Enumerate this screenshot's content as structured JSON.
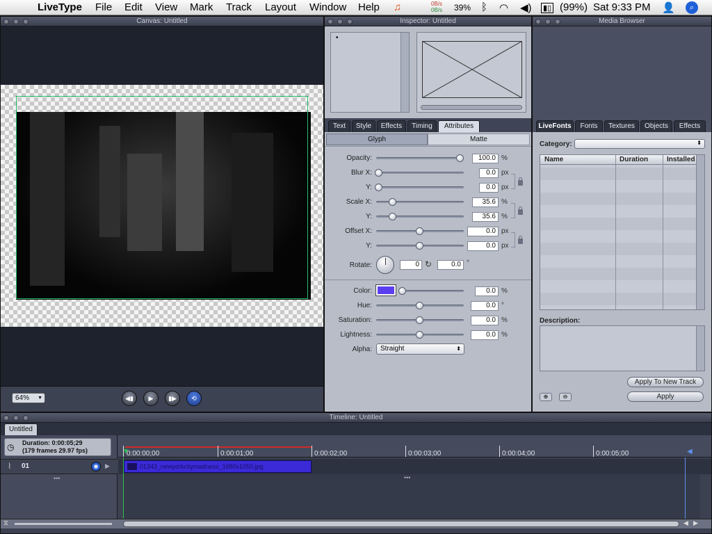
{
  "menubar": {
    "app": "LiveType",
    "menus": [
      "File",
      "Edit",
      "View",
      "Mark",
      "Track",
      "Layout",
      "Window",
      "Help"
    ],
    "net_up": "0B/s",
    "net_down": "0B/s",
    "cpu": "39%",
    "battery": "(99%)",
    "clock": "Sat 9:33 PM"
  },
  "canvas": {
    "title": "Canvas: Untitled",
    "zoom": "64%"
  },
  "inspector": {
    "title": "Inspector: Untitled",
    "tabs": [
      "Text",
      "Style",
      "Effects",
      "Timing",
      "Attributes"
    ],
    "active_tab": "Attributes",
    "subtabs": [
      "Glyph",
      "Matte"
    ],
    "active_subtab": "Glyph",
    "params": {
      "opacity": {
        "label": "Opacity:",
        "value": "100.0",
        "unit": "%",
        "slider": 0.97
      },
      "blur_x": {
        "label": "Blur X:",
        "value": "0.0",
        "unit": "px",
        "slider": 0.0
      },
      "blur_y": {
        "label": "Y:",
        "value": "0.0",
        "unit": "px",
        "slider": 0.0
      },
      "scale_x": {
        "label": "Scale X:",
        "value": "35.6",
        "unit": "%",
        "slider": 0.16
      },
      "scale_y": {
        "label": "Y:",
        "value": "35.6",
        "unit": "%",
        "slider": 0.16
      },
      "offset_x": {
        "label": "Offset X:",
        "value": "0.0",
        "unit": "px",
        "slider": 0.5
      },
      "offset_y": {
        "label": "Y:",
        "value": "0.0",
        "unit": "px",
        "slider": 0.5
      },
      "rotate": {
        "label": "Rotate:",
        "turns": "0",
        "degrees": "0.0",
        "unit": "°"
      },
      "color": {
        "label": "Color:",
        "value": "0.0",
        "unit": "%",
        "swatch": "#5b3ef0",
        "slider": 0.0
      },
      "hue": {
        "label": "Hue:",
        "value": "0.0",
        "unit": "°",
        "slider": 0.5
      },
      "saturation": {
        "label": "Saturation:",
        "value": "0.0",
        "unit": "%",
        "slider": 0.5
      },
      "lightness": {
        "label": "Lightness:",
        "value": "0.0",
        "unit": "%",
        "slider": 0.5
      },
      "alpha": {
        "label": "Alpha:",
        "value": "Straight"
      }
    }
  },
  "media_browser": {
    "title": "Media Browser",
    "tabs": [
      "LiveFonts",
      "Fonts",
      "Textures",
      "Objects",
      "Effects"
    ],
    "active_tab": "LiveFonts",
    "category_label": "Category:",
    "columns": [
      "Name",
      "Duration",
      "Installed"
    ],
    "description_label": "Description:",
    "apply_new_track": "Apply To New Track",
    "apply": "Apply"
  },
  "timeline": {
    "title": "Timeline: Untitled",
    "tab": "Untitled",
    "duration": "Duration: 0:00:05;29",
    "frames": "(179 frames 29.97 fps)",
    "ruler": [
      "0:00:00;00",
      "0:00:01;00",
      "0:00:02;00",
      "0:00:03;00",
      "0:00:04;00",
      "0:00:05;00"
    ],
    "track_label": "01",
    "clip": "01343_newyorkcitymadness_1680x1050.jpg"
  }
}
